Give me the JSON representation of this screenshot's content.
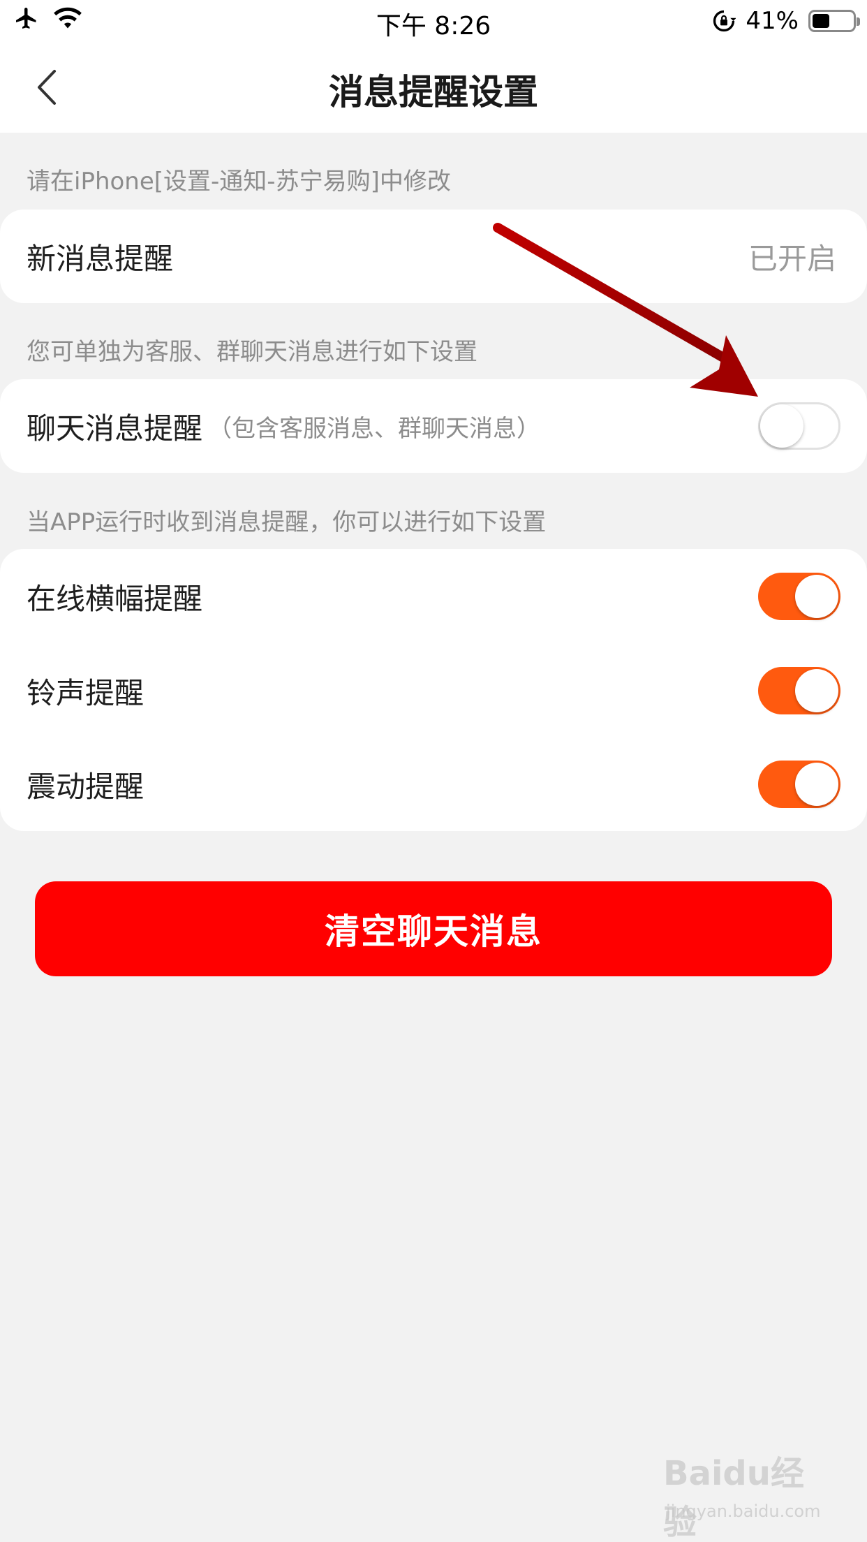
{
  "status_bar": {
    "time": "下午 8:26",
    "battery_percent": "41%",
    "icons": [
      "airplane-icon",
      "wifi-icon",
      "rotation-lock-icon",
      "battery-icon"
    ]
  },
  "nav": {
    "title": "消息提醒设置",
    "back_icon": "chevron-left-icon"
  },
  "section1": {
    "hint": "请在iPhone[设置-通知-苏宁易购]中修改",
    "row": {
      "label": "新消息提醒",
      "value": "已开启"
    }
  },
  "section2": {
    "hint": "您可单独为客服、群聊天消息进行如下设置",
    "row": {
      "label": "聊天消息提醒",
      "sub": "（包含客服消息、群聊天消息）",
      "on": false
    }
  },
  "section3": {
    "hint": "当APP运行时收到消息提醒，你可以进行如下设置",
    "rows": [
      {
        "label": "在线横幅提醒",
        "on": true
      },
      {
        "label": "铃声提醒",
        "on": true
      },
      {
        "label": "震动提醒",
        "on": true
      }
    ]
  },
  "clear_button": {
    "label": "清空聊天消息"
  },
  "colors": {
    "accent_toggle": "#ff5a0f",
    "danger_button": "#ff0000",
    "annotation_arrow": "#b00000",
    "background": "#f2f2f2"
  },
  "watermark": {
    "main": "Baidu经验",
    "sub": "jingyan.baidu.com"
  }
}
